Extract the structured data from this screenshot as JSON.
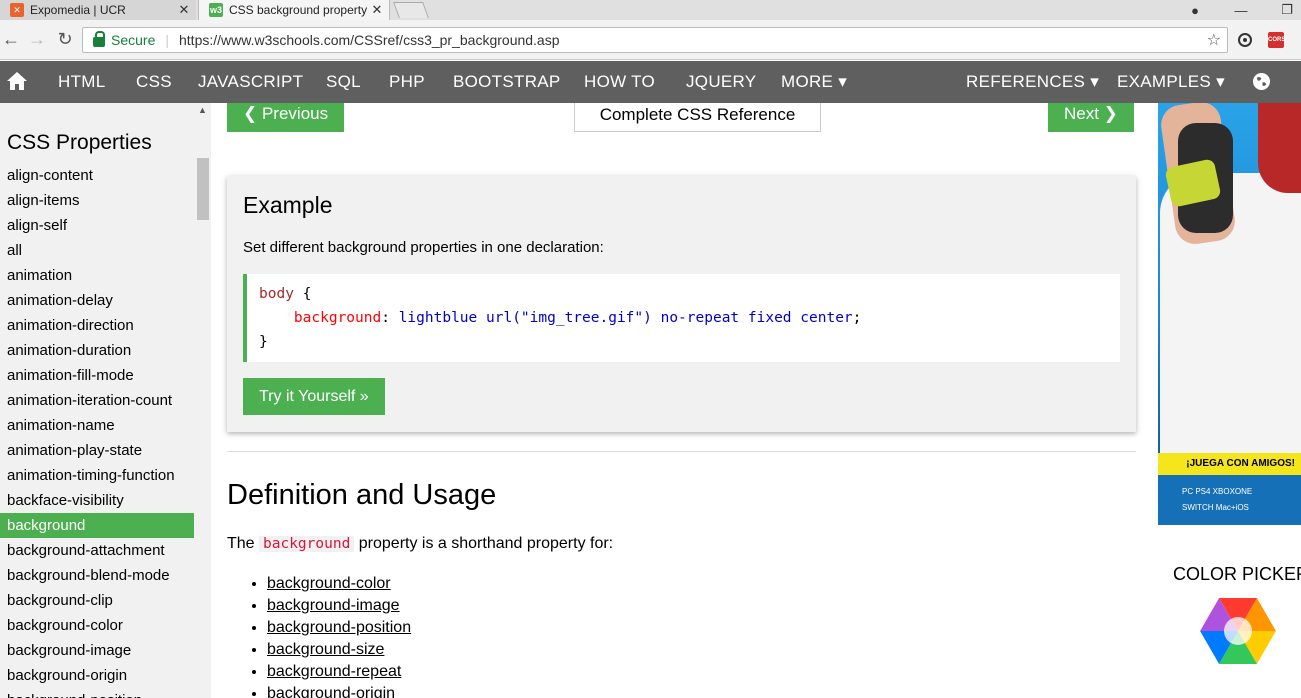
{
  "browser": {
    "tabs": [
      {
        "title": "Expomedia | UCR",
        "favicon_color": "#e8642c",
        "active": false
      },
      {
        "title": "CSS background property",
        "favicon_color": "#4caf50",
        "active": true
      }
    ],
    "address": {
      "secure_label": "Secure",
      "url": "https://www.w3schools.com/CSSref/css3_pr_background.asp"
    },
    "ext_label": "CORS"
  },
  "nav": {
    "items": [
      "HTML",
      "CSS",
      "JAVASCRIPT",
      "SQL",
      "PHP",
      "BOOTSTRAP",
      "HOW TO",
      "JQUERY",
      "MORE ▾"
    ],
    "right_items": [
      "REFERENCES ▾",
      "EXAMPLES ▾"
    ]
  },
  "sidebar": {
    "title": "CSS Properties",
    "items": [
      "align-content",
      "align-items",
      "align-self",
      "all",
      "animation",
      "animation-delay",
      "animation-direction",
      "animation-duration",
      "animation-fill-mode",
      "animation-iteration-count",
      "animation-name",
      "animation-play-state",
      "animation-timing-function",
      "backface-visibility",
      "background",
      "background-attachment",
      "background-blend-mode",
      "background-clip",
      "background-color",
      "background-image",
      "background-origin",
      "background-position"
    ],
    "active_item": "background"
  },
  "main": {
    "prev_label": "❮ Previous",
    "next_label": "Next ❯",
    "reference_label": "Complete CSS Reference",
    "example": {
      "title": "Example",
      "description": "Set different background properties in one declaration:",
      "code": {
        "selector": "body",
        "open": " {",
        "property": "background",
        "colon": ": ",
        "value": "lightblue url(\"img_tree.gif\") no-repeat fixed center",
        "semi": ";",
        "close": "}"
      },
      "try_label": "Try it Yourself »"
    },
    "definition_title": "Definition and Usage",
    "intro_before": "The ",
    "intro_keyword": "background",
    "intro_after": " property is a shorthand property for:",
    "links": [
      "background-color",
      "background-image",
      "background-position",
      "background-size",
      "background-repeat",
      "background-origin"
    ]
  },
  "ad": {
    "banner": "¡JUEGA CON AMIGOS!",
    "platforms_row1": "PC   PS4   XBOXONE",
    "platforms_row2": "SWITCH   Mac+iOS"
  },
  "color_picker": {
    "title": "COLOR PICKER"
  },
  "colors": {
    "accent": "#4caf50",
    "nav_bg": "#5f5f5f",
    "sidebar_bg": "#f1f1f1"
  }
}
